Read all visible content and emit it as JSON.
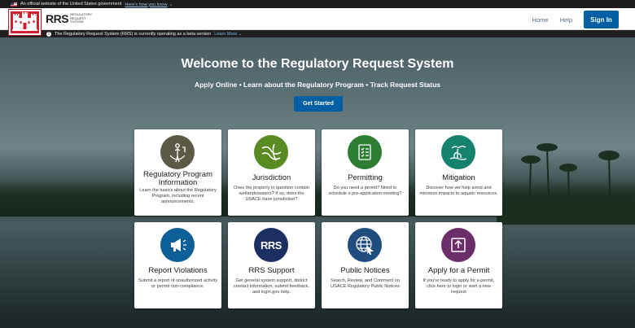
{
  "gov_banner": {
    "text": "An official website of the United States government",
    "link": "Here's how you know"
  },
  "header": {
    "logo_letters": "RRS",
    "logo_sub": [
      "Regulatory",
      "Request",
      "System"
    ],
    "nav": [
      "Home",
      "Help"
    ],
    "signin": "Sign In"
  },
  "beta": {
    "text": "The Regulatory Request System (RRS) is currently operating as a beta version",
    "link": "Learn More"
  },
  "hero": {
    "title": "Welcome to the Regulatory Request System",
    "subtitle": "Apply Online • Learn about the Regulatory Program • Track Request Status",
    "cta": "Get Started"
  },
  "cards": [
    {
      "title": "Regulatory Program Information",
      "desc": "Learn the basics about the Regulatory Program, including recent announcements.",
      "icon": "regulatory-program-icon",
      "color": "#5c5a45"
    },
    {
      "title": "Jurisdiction",
      "desc": "Does the property in question contain wetlands/waters? If so, does the USACE have jurisdiction?",
      "icon": "jurisdiction-icon",
      "color": "#588b22"
    },
    {
      "title": "Permitting",
      "desc": "Do you need a permit? Need to schedule a pre-application meeting?",
      "icon": "permitting-icon",
      "color": "#2e7d32"
    },
    {
      "title": "Mitigation",
      "desc": "Discover how we help avoid and minimize impacts to aquatic resources.",
      "icon": "mitigation-icon",
      "color": "#14826d"
    },
    {
      "title": "Report Violations",
      "desc": "Submit a report of unauthorized activity or permit non-compliance.",
      "icon": "megaphone-icon",
      "color": "#0d5f97"
    },
    {
      "title": "RRS Support",
      "desc": "Get general system support, district contact information, submit feedback, and login.gov help.",
      "icon": "rrs-support-icon",
      "color": "#1c2f63"
    },
    {
      "title": "Public Notices",
      "desc": "Search, Review, and Comment on USACE Regulatory Public Notices",
      "icon": "globe-cursor-icon",
      "color": "#1f4d7d"
    },
    {
      "title": "Apply for a Permit",
      "desc": "If you're ready to apply for a permit, click here to login or start a new request",
      "icon": "apply-upload-icon",
      "color": "#6b2e6b"
    }
  ]
}
